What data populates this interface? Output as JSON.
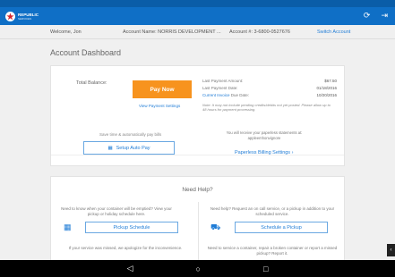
{
  "app": {
    "logo_line1": "REPUBLIC",
    "logo_line2": "SERVICES"
  },
  "topline": {
    "welcome": "Welcome, Jon",
    "account_name": "Account Name: NORRIS DEVELOPMENT ...",
    "account_number": "Account #: 3-6800-0527676",
    "switch_account": "Switch Account"
  },
  "dashboard": {
    "title": "Account Dashboard",
    "total_balance_label": "Total Balance:",
    "pay_now": "Pay Now",
    "view_payment_settings": "View Payment Settings",
    "last_payment_amount_label": "Last Payment Amount:",
    "last_payment_amount": "$67.50",
    "last_payment_date_label": "Last Payment Date:",
    "last_payment_date": "01/18/2016",
    "current_invoice_prefix": "Current Invoice",
    "current_invoice_suffix": "Due Date:",
    "current_invoice_due": "10/20/2016",
    "note": "Note: It may not include pending credits/debits not yet posted. Please allow up to 48 hours for payment processing.",
    "autopay_text": "Save time & automatically pay bills",
    "setup_autopay": "Setup Auto Pay",
    "paperless_text": "You will receive your paperless statements at: appleemhonvignore",
    "paperless_settings": "Paperless Billing Settings"
  },
  "help": {
    "title": "Need Help?",
    "left_text": "Need to know when your container will be emptied? View your pickup or holiday schedule here.",
    "pickup_schedule": "Pickup Schedule",
    "right_text": "Need help? Request an on call service, or a pickup in addition to your scheduled service.",
    "schedule_pickup": "Schedule a Pickup",
    "left_text2": "If your service was missed, we apologize for the inconvenience.",
    "right_text2": "Need to service a container, repair a broken container or report a missed pickup? Report it."
  },
  "icons": {
    "refresh": "refresh-icon",
    "logout": "logout-icon"
  },
  "colors": {
    "brand_blue": "#0f6fc6",
    "accent_orange": "#f7931e",
    "link_blue": "#1f7cd6"
  }
}
